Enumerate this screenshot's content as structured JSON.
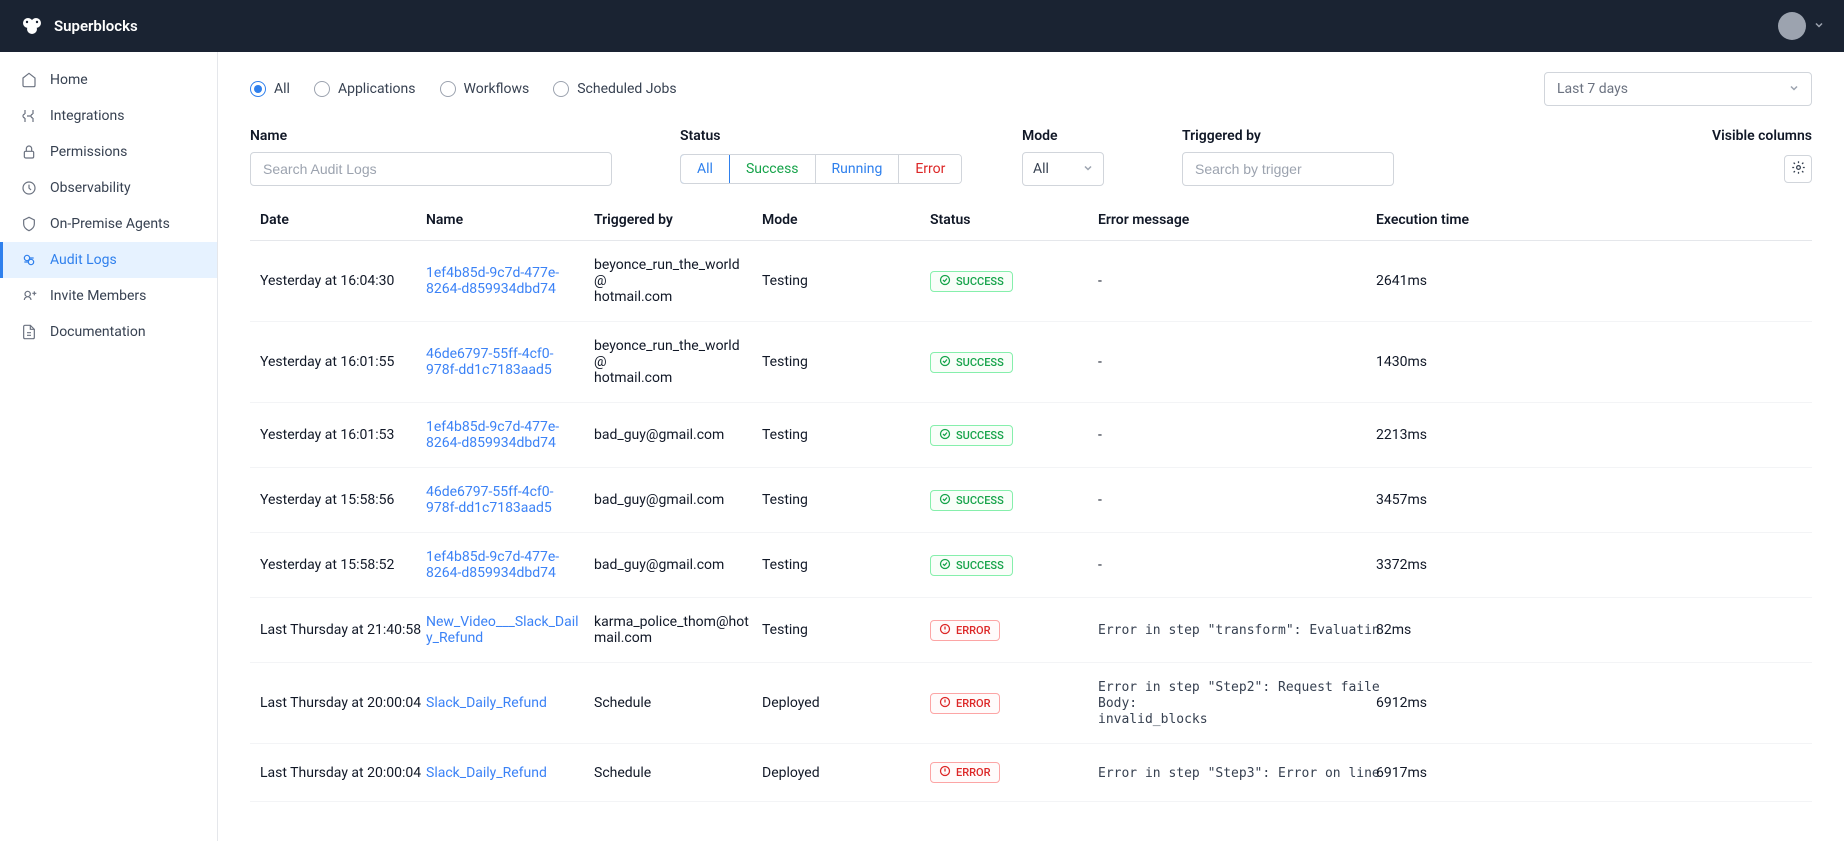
{
  "brand": "Superblocks",
  "sidebar": [
    {
      "icon": "home",
      "label": "Home"
    },
    {
      "icon": "integrations",
      "label": "Integrations"
    },
    {
      "icon": "permissions",
      "label": "Permissions"
    },
    {
      "icon": "observability",
      "label": "Observability"
    },
    {
      "icon": "agents",
      "label": "On-Premise Agents"
    },
    {
      "icon": "audit",
      "label": "Audit Logs"
    },
    {
      "icon": "invite",
      "label": "Invite Members"
    },
    {
      "icon": "docs",
      "label": "Documentation"
    }
  ],
  "radios": [
    "All",
    "Applications",
    "Workflows",
    "Scheduled Jobs"
  ],
  "dateRange": "Last 7 days",
  "filterLabels": {
    "name": "Name",
    "status": "Status",
    "mode": "Mode",
    "trig": "Triggered by",
    "vis": "Visible columns"
  },
  "placeholders": {
    "name": "Search Audit Logs",
    "trig": "Search by trigger"
  },
  "statusSeg": {
    "all": "All",
    "success": "Success",
    "running": "Running",
    "error": "Error"
  },
  "modeSel": "All",
  "headers": {
    "date": "Date",
    "name": "Name",
    "trig": "Triggered by",
    "mode": "Mode",
    "status": "Status",
    "err": "Error message",
    "exec": "Execution time"
  },
  "rows": [
    {
      "date": "Yesterday at 16:04:30",
      "name": "1ef4b85d-9c7d-477e-8264-d859934dbd74",
      "trig": "beyonce_run_the_world@\nhotmail.com",
      "mode": "Testing",
      "status": "SUCCESS",
      "err": "-",
      "exec": "2641ms"
    },
    {
      "date": "Yesterday at 16:01:55",
      "name": "46de6797-55ff-4cf0-978f-dd1c7183aad5",
      "trig": "beyonce_run_the_world@\nhotmail.com",
      "mode": "Testing",
      "status": "SUCCESS",
      "err": "-",
      "exec": "1430ms"
    },
    {
      "date": "Yesterday at 16:01:53",
      "name": "1ef4b85d-9c7d-477e-8264-d859934dbd74",
      "trig": "bad_guy@gmail.com",
      "mode": "Testing",
      "status": "SUCCESS",
      "err": "-",
      "exec": "2213ms"
    },
    {
      "date": "Yesterday at 15:58:56",
      "name": "46de6797-55ff-4cf0-978f-dd1c7183aad5",
      "trig": "bad_guy@gmail.com",
      "mode": "Testing",
      "status": "SUCCESS",
      "err": "-",
      "exec": "3457ms"
    },
    {
      "date": "Yesterday at 15:58:52",
      "name": "1ef4b85d-9c7d-477e-8264-d859934dbd74",
      "trig": "bad_guy@gmail.com",
      "mode": "Testing",
      "status": "SUCCESS",
      "err": "-",
      "exec": "3372ms"
    },
    {
      "date": "Last Thursday at 21:40:58",
      "name": "New_Video___Slack_Daily_Refund",
      "trig": "karma_police_thom@hot\nmail.com",
      "mode": "Testing",
      "status": "ERROR",
      "err": "Error in step \"transform\": Evaluatin",
      "exec": "82ms"
    },
    {
      "date": "Last Thursday at 20:00:04",
      "name": "Slack_Daily_Refund",
      "trig": "Schedule",
      "mode": "Deployed",
      "status": "ERROR",
      "err": "Error in step \"Step2\": Request faile\nBody:\ninvalid_blocks",
      "exec": "6912ms"
    },
    {
      "date": "Last Thursday at 20:00:04",
      "name": "Slack_Daily_Refund",
      "trig": "Schedule",
      "mode": "Deployed",
      "status": "ERROR",
      "err": "Error in step \"Step3\": Error on line",
      "exec": "6917ms"
    }
  ]
}
